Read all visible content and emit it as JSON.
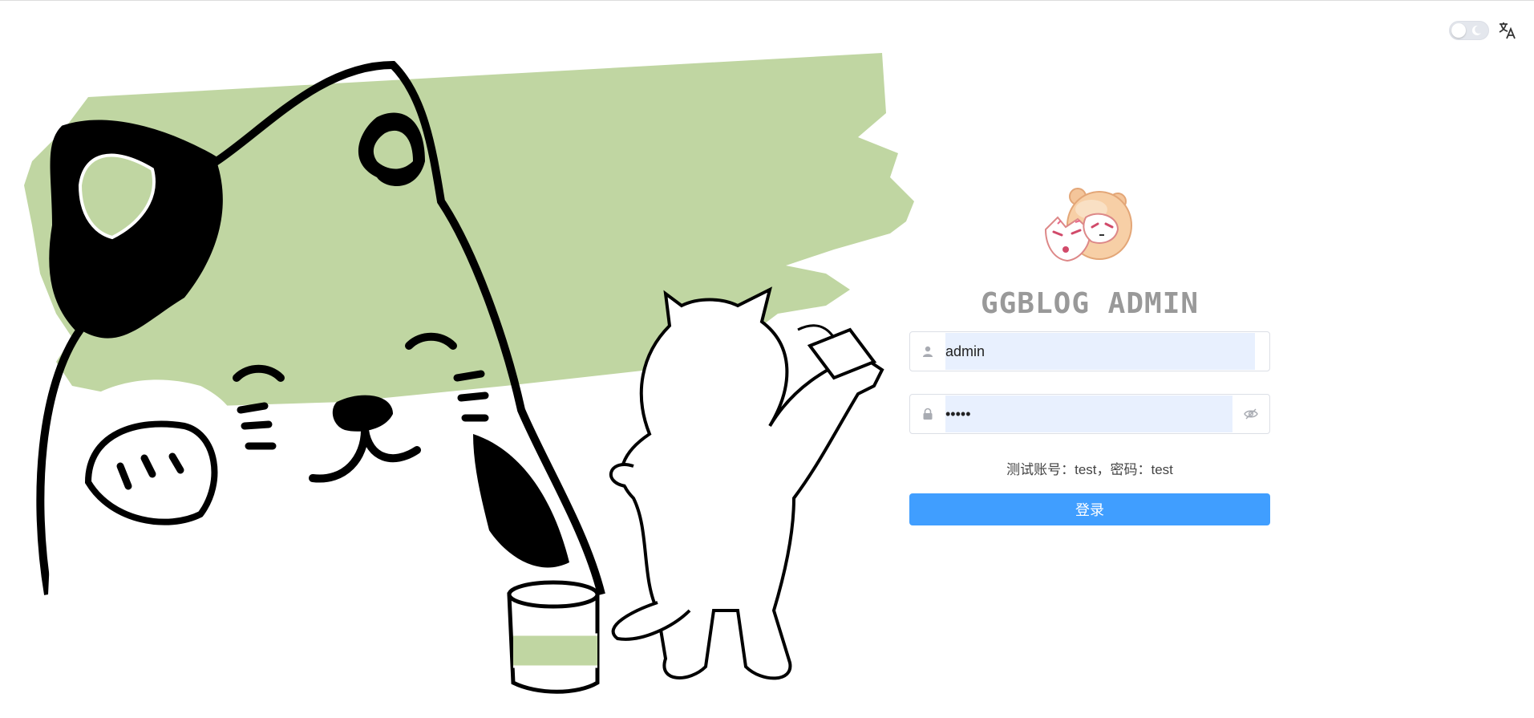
{
  "header": {
    "theme_toggle_icon": "moon-icon",
    "language_icon": "translate-icon"
  },
  "login": {
    "avatar_icon": "bear-with-mask-mascot",
    "title": "GGBLOG ADMIN",
    "username": {
      "icon": "user-icon",
      "value": "admin"
    },
    "password": {
      "icon": "lock-icon",
      "value": "•••••",
      "toggle_icon": "eye-hidden-icon"
    },
    "hint": "测试账号：test，密码：test",
    "submit_label": "登录"
  },
  "colors": {
    "accent": "#409eff",
    "input_fill": "#e8f0fe",
    "paint_green": "#c0d6a2",
    "title_gray": "#999999"
  }
}
